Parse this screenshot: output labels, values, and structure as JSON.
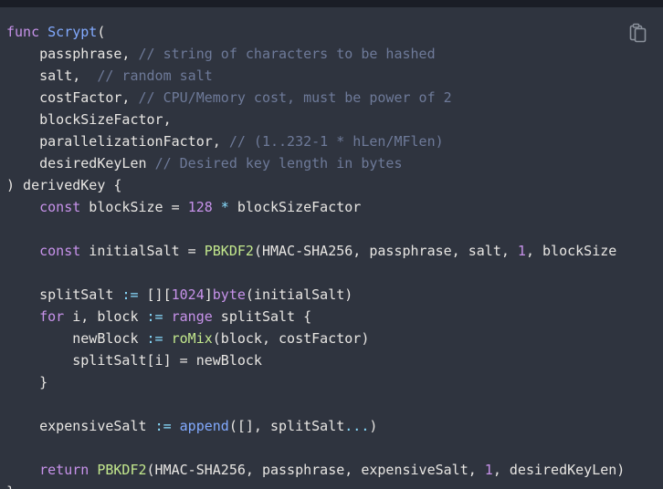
{
  "code": {
    "lines": [
      [
        {
          "t": "func ",
          "c": "kw"
        },
        {
          "t": "Scrypt",
          "c": "fn"
        },
        {
          "t": "(",
          "c": "punc"
        }
      ],
      [
        {
          "t": "    passphrase, ",
          "c": "punc"
        },
        {
          "t": "// string of characters to be hashed",
          "c": "cm"
        }
      ],
      [
        {
          "t": "    salt,  ",
          "c": "punc"
        },
        {
          "t": "// random salt",
          "c": "cm"
        }
      ],
      [
        {
          "t": "    costFactor, ",
          "c": "punc"
        },
        {
          "t": "// CPU/Memory cost, must be power of 2",
          "c": "cm"
        }
      ],
      [
        {
          "t": "    blockSizeFactor,",
          "c": "punc"
        }
      ],
      [
        {
          "t": "    parallelizationFactor, ",
          "c": "punc"
        },
        {
          "t": "// (1..232-1 * hLen/MFlen)",
          "c": "cm"
        }
      ],
      [
        {
          "t": "    desiredKeyLen ",
          "c": "punc"
        },
        {
          "t": "// Desired key length in bytes",
          "c": "cm"
        }
      ],
      [
        {
          "t": ") derivedKey {",
          "c": "punc"
        }
      ],
      [
        {
          "t": "    ",
          "c": "punc"
        },
        {
          "t": "const",
          "c": "kw"
        },
        {
          "t": " blockSize = ",
          "c": "punc"
        },
        {
          "t": "128",
          "c": "num"
        },
        {
          "t": " * ",
          "c": "op"
        },
        {
          "t": "blockSizeFactor",
          "c": "punc"
        }
      ],
      [],
      [
        {
          "t": "    ",
          "c": "punc"
        },
        {
          "t": "const",
          "c": "kw"
        },
        {
          "t": " initialSalt = ",
          "c": "punc"
        },
        {
          "t": "PBKDF2",
          "c": "call"
        },
        {
          "t": "(HMAC-SHA256, passphrase, salt, ",
          "c": "punc"
        },
        {
          "t": "1",
          "c": "num"
        },
        {
          "t": ", blockSize",
          "c": "punc"
        }
      ],
      [],
      [
        {
          "t": "    splitSalt ",
          "c": "punc"
        },
        {
          "t": ":=",
          "c": "op"
        },
        {
          "t": " [][",
          "c": "punc"
        },
        {
          "t": "1024",
          "c": "num"
        },
        {
          "t": "]",
          "c": "punc"
        },
        {
          "t": "byte",
          "c": "kw"
        },
        {
          "t": "(initialSalt)",
          "c": "punc"
        }
      ],
      [
        {
          "t": "    ",
          "c": "punc"
        },
        {
          "t": "for",
          "c": "kw"
        },
        {
          "t": " i, block ",
          "c": "punc"
        },
        {
          "t": ":=",
          "c": "op"
        },
        {
          "t": " ",
          "c": "punc"
        },
        {
          "t": "range",
          "c": "kw"
        },
        {
          "t": " splitSalt {",
          "c": "punc"
        }
      ],
      [
        {
          "t": "        newBlock ",
          "c": "punc"
        },
        {
          "t": ":=",
          "c": "op"
        },
        {
          "t": " ",
          "c": "punc"
        },
        {
          "t": "roMix",
          "c": "call"
        },
        {
          "t": "(block, costFactor)",
          "c": "punc"
        }
      ],
      [
        {
          "t": "        splitSalt[i] = newBlock",
          "c": "punc"
        }
      ],
      [
        {
          "t": "    }",
          "c": "punc"
        }
      ],
      [],
      [
        {
          "t": "    expensiveSalt ",
          "c": "punc"
        },
        {
          "t": ":=",
          "c": "op"
        },
        {
          "t": " ",
          "c": "punc"
        },
        {
          "t": "append",
          "c": "fn"
        },
        {
          "t": "([], splitSalt",
          "c": "punc"
        },
        {
          "t": "...",
          "c": "op"
        },
        {
          "t": ")",
          "c": "punc"
        }
      ],
      [],
      [
        {
          "t": "    ",
          "c": "punc"
        },
        {
          "t": "return",
          "c": "kw"
        },
        {
          "t": " ",
          "c": "punc"
        },
        {
          "t": "PBKDF2",
          "c": "call"
        },
        {
          "t": "(HMAC-SHA256, passphrase, expensiveSalt, ",
          "c": "punc"
        },
        {
          "t": "1",
          "c": "num"
        },
        {
          "t": ", desiredKeyLen)",
          "c": "punc"
        }
      ],
      [
        {
          "t": "}",
          "c": "punc"
        }
      ]
    ]
  },
  "toolbar": {
    "copy_icon": "clipboard-icon"
  }
}
